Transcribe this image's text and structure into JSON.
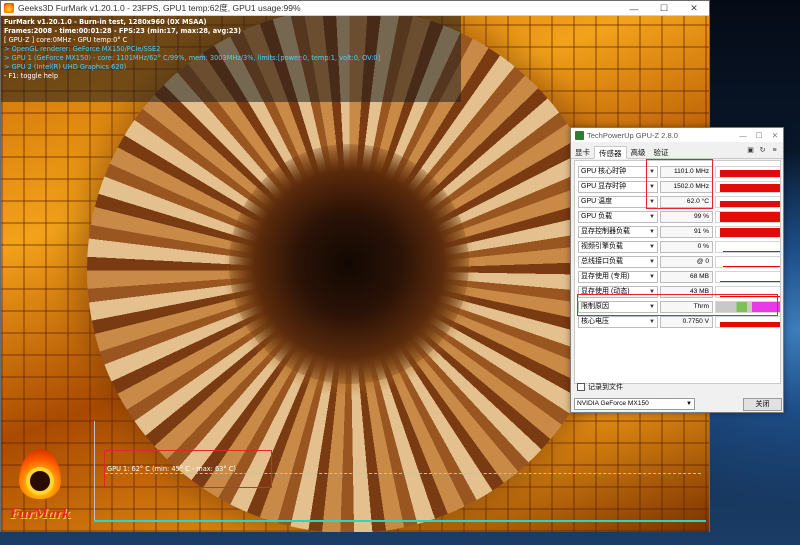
{
  "furmark": {
    "title": "Geeks3D FurMark v1.20.1.0 - 23FPS, GPU1 temp:62度, GPU1 usage:99%",
    "window_buttons": [
      "—",
      "☐",
      "✕"
    ],
    "overlay": [
      "FurMark v1.20.1.0 - Burn-in test, 1280x960 (0X MSAA)",
      "Frames:2008 - time:00:01:28 - FPS:23 (min:17, max:28, avg:23)",
      "[ GPU-Z ] core:0MHz - GPU temp:0° C",
      "> OpenGL renderer: GeForce MX150/PCIe/SSE2",
      "> GPU 1 (GeForce MX150) - core: 1101MHz/62° C/99%, mem: 3003MHz/3%, limits:[power:0, temp:1, volt:0, OV:0]",
      "> GPU 2 (Intel(R) UHD Graphics 620)",
      "- F1: toggle help"
    ],
    "temp_graph_label": "GPU 1: 62° C (min: 45° C - max: 63° C)",
    "logo_text": "FurMark"
  },
  "gpuz": {
    "title": "TechPowerUp GPU-Z 2.8.0",
    "window_buttons": [
      "—",
      "☐",
      "✕"
    ],
    "tabs": [
      "显卡",
      "传感器",
      "高级",
      "验证"
    ],
    "active_tab": "传感器",
    "tool_icons": [
      "camera-icon",
      "refresh-icon",
      "menu-icon"
    ],
    "tool_glyphs": [
      "▣",
      "↻",
      "≡"
    ],
    "sensors": [
      {
        "label": "GPU 核心时钟",
        "value": "1101.0 MHz",
        "level": 0.7
      },
      {
        "label": "GPU 显存时钟",
        "value": "1502.0 MHz",
        "level": 0.8
      },
      {
        "label": "GPU 温度",
        "value": "62.0 °C",
        "level": 0.6
      },
      {
        "label": "GPU 负载",
        "value": "99 %",
        "level": 0.99
      },
      {
        "label": "显存控制器负载",
        "value": "91 %",
        "level": 0.91
      },
      {
        "label": "视频引擎负载",
        "value": "0 %",
        "level": 0
      },
      {
        "label": "总线接口负载",
        "value": "@ 0",
        "level": 0
      },
      {
        "label": "显存使用 (专用)",
        "value": "68 MB",
        "level": 0.05
      },
      {
        "label": "显存使用 (动态)",
        "value": "43 MB",
        "level": 0.04
      },
      {
        "label": "限制原因",
        "value": "Thrm",
        "level": 1
      },
      {
        "label": "核心电压",
        "value": "0.7750 V",
        "level": 0.5
      }
    ],
    "log_checkbox_label": "记录到文件",
    "gpu_select": "NVIDIA GeForce MX150",
    "close_label": "关闭",
    "graph_color": "#e10b0b",
    "limit_colors": [
      "#c8c8c8",
      "#7fbf5a",
      "#e63be6"
    ]
  },
  "highlight_color": "#e3262e"
}
